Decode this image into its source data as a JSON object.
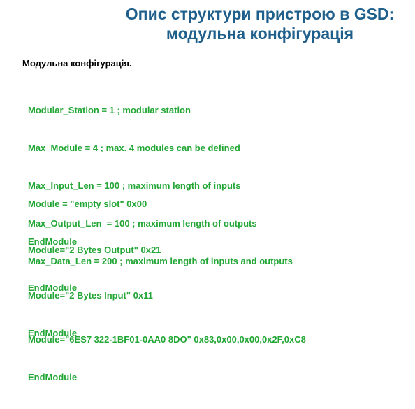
{
  "title": {
    "line1": "Опис структури пристрою в GSD:",
    "line2": "модульна конфігурація"
  },
  "subtitle": "Модульна конфігурація.",
  "params": [
    "Modular_Station = 1 ; modular station",
    "Max_Module = 4 ; max. 4 modules can be defined",
    "Max_Input_Len = 100 ; maximum length of inputs",
    "Max_Output_Len  = 100 ; maximum length of outputs",
    "Max_Data_Len = 200 ; maximum length of inputs and outputs"
  ],
  "modules": [
    {
      "def": "Module = \"empty slot\" 0x00",
      "end": "EndModule"
    },
    {
      "def": "Module=\"2 Bytes Output\" 0x21",
      "end": "EndModule"
    },
    {
      "def": "Module=\"2 Bytes Input\" 0x11",
      "end": "EndModule"
    },
    {
      "def": "Module=\"6ES7 322-1BF01-0AA0 8DO\" 0x83,0x00,0x00,0x2F,0xC8",
      "end": "EndModule"
    }
  ],
  "colors": {
    "title": "#1f5f8b",
    "code": "#22a635",
    "subtitle": "#000000"
  }
}
